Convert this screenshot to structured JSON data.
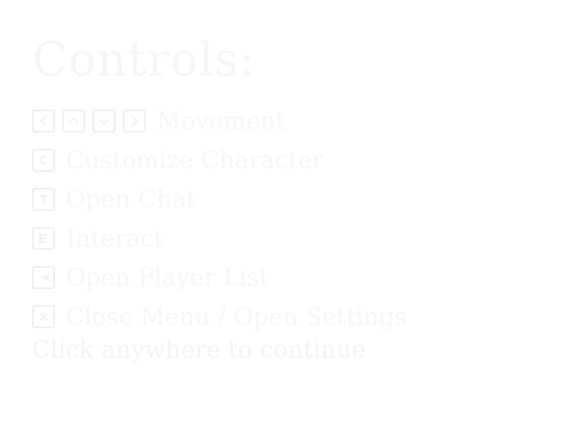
{
  "title": "Controls:",
  "controls": [
    {
      "keys": [
        "arrow-left-key-icon",
        "arrow-up-key-icon",
        "arrow-down-key-icon",
        "arrow-right-key-icon"
      ],
      "label": "Movement"
    },
    {
      "keys": [
        "c-key-icon"
      ],
      "label": "Customize Character"
    },
    {
      "keys": [
        "t-key-icon"
      ],
      "label": "Open Chat"
    },
    {
      "keys": [
        "e-key-icon"
      ],
      "label": "Interact"
    },
    {
      "keys": [
        "tab-key-icon"
      ],
      "label": "Open Player List"
    },
    {
      "keys": [
        "escape-key-icon"
      ],
      "label": "Close Menu / Open Settings"
    }
  ],
  "continue_text": "Click anywhere to continue",
  "colors": {
    "background": "#ffffff",
    "text": "#f6f6f6"
  }
}
